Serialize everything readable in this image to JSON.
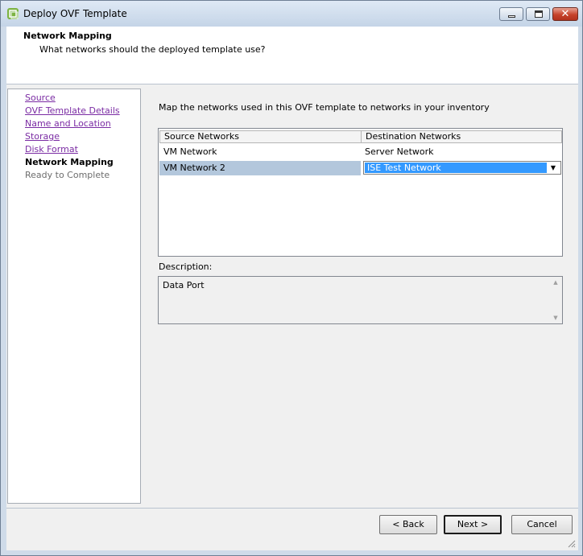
{
  "window": {
    "title": "Deploy OVF Template"
  },
  "header": {
    "title": "Network Mapping",
    "subtitle": "What networks should the deployed template use?"
  },
  "nav": {
    "items": [
      {
        "label": "Source",
        "state": "link"
      },
      {
        "label": "OVF Template Details",
        "state": "link"
      },
      {
        "label": "Name and Location",
        "state": "link"
      },
      {
        "label": "Storage",
        "state": "link"
      },
      {
        "label": "Disk Format",
        "state": "link"
      },
      {
        "label": "Network Mapping",
        "state": "current"
      },
      {
        "label": "Ready to Complete",
        "state": "future"
      }
    ]
  },
  "main": {
    "instruction": "Map the networks used in this OVF template to networks in your inventory",
    "table": {
      "columns": [
        "Source Networks",
        "Destination Networks"
      ],
      "rows": [
        {
          "source": "VM Network",
          "destination": "Server Network"
        },
        {
          "source": "VM Network 2",
          "destination": "ISE Test Network"
        }
      ]
    },
    "description_label": "Description:",
    "description_text": "Data Port"
  },
  "footer": {
    "back_label": "< Back",
    "next_label": "Next >",
    "cancel_label": "Cancel"
  },
  "colors": {
    "selection": "#3399ff",
    "row_selected": "#b3c7dc",
    "link": "#7a2ba3"
  }
}
